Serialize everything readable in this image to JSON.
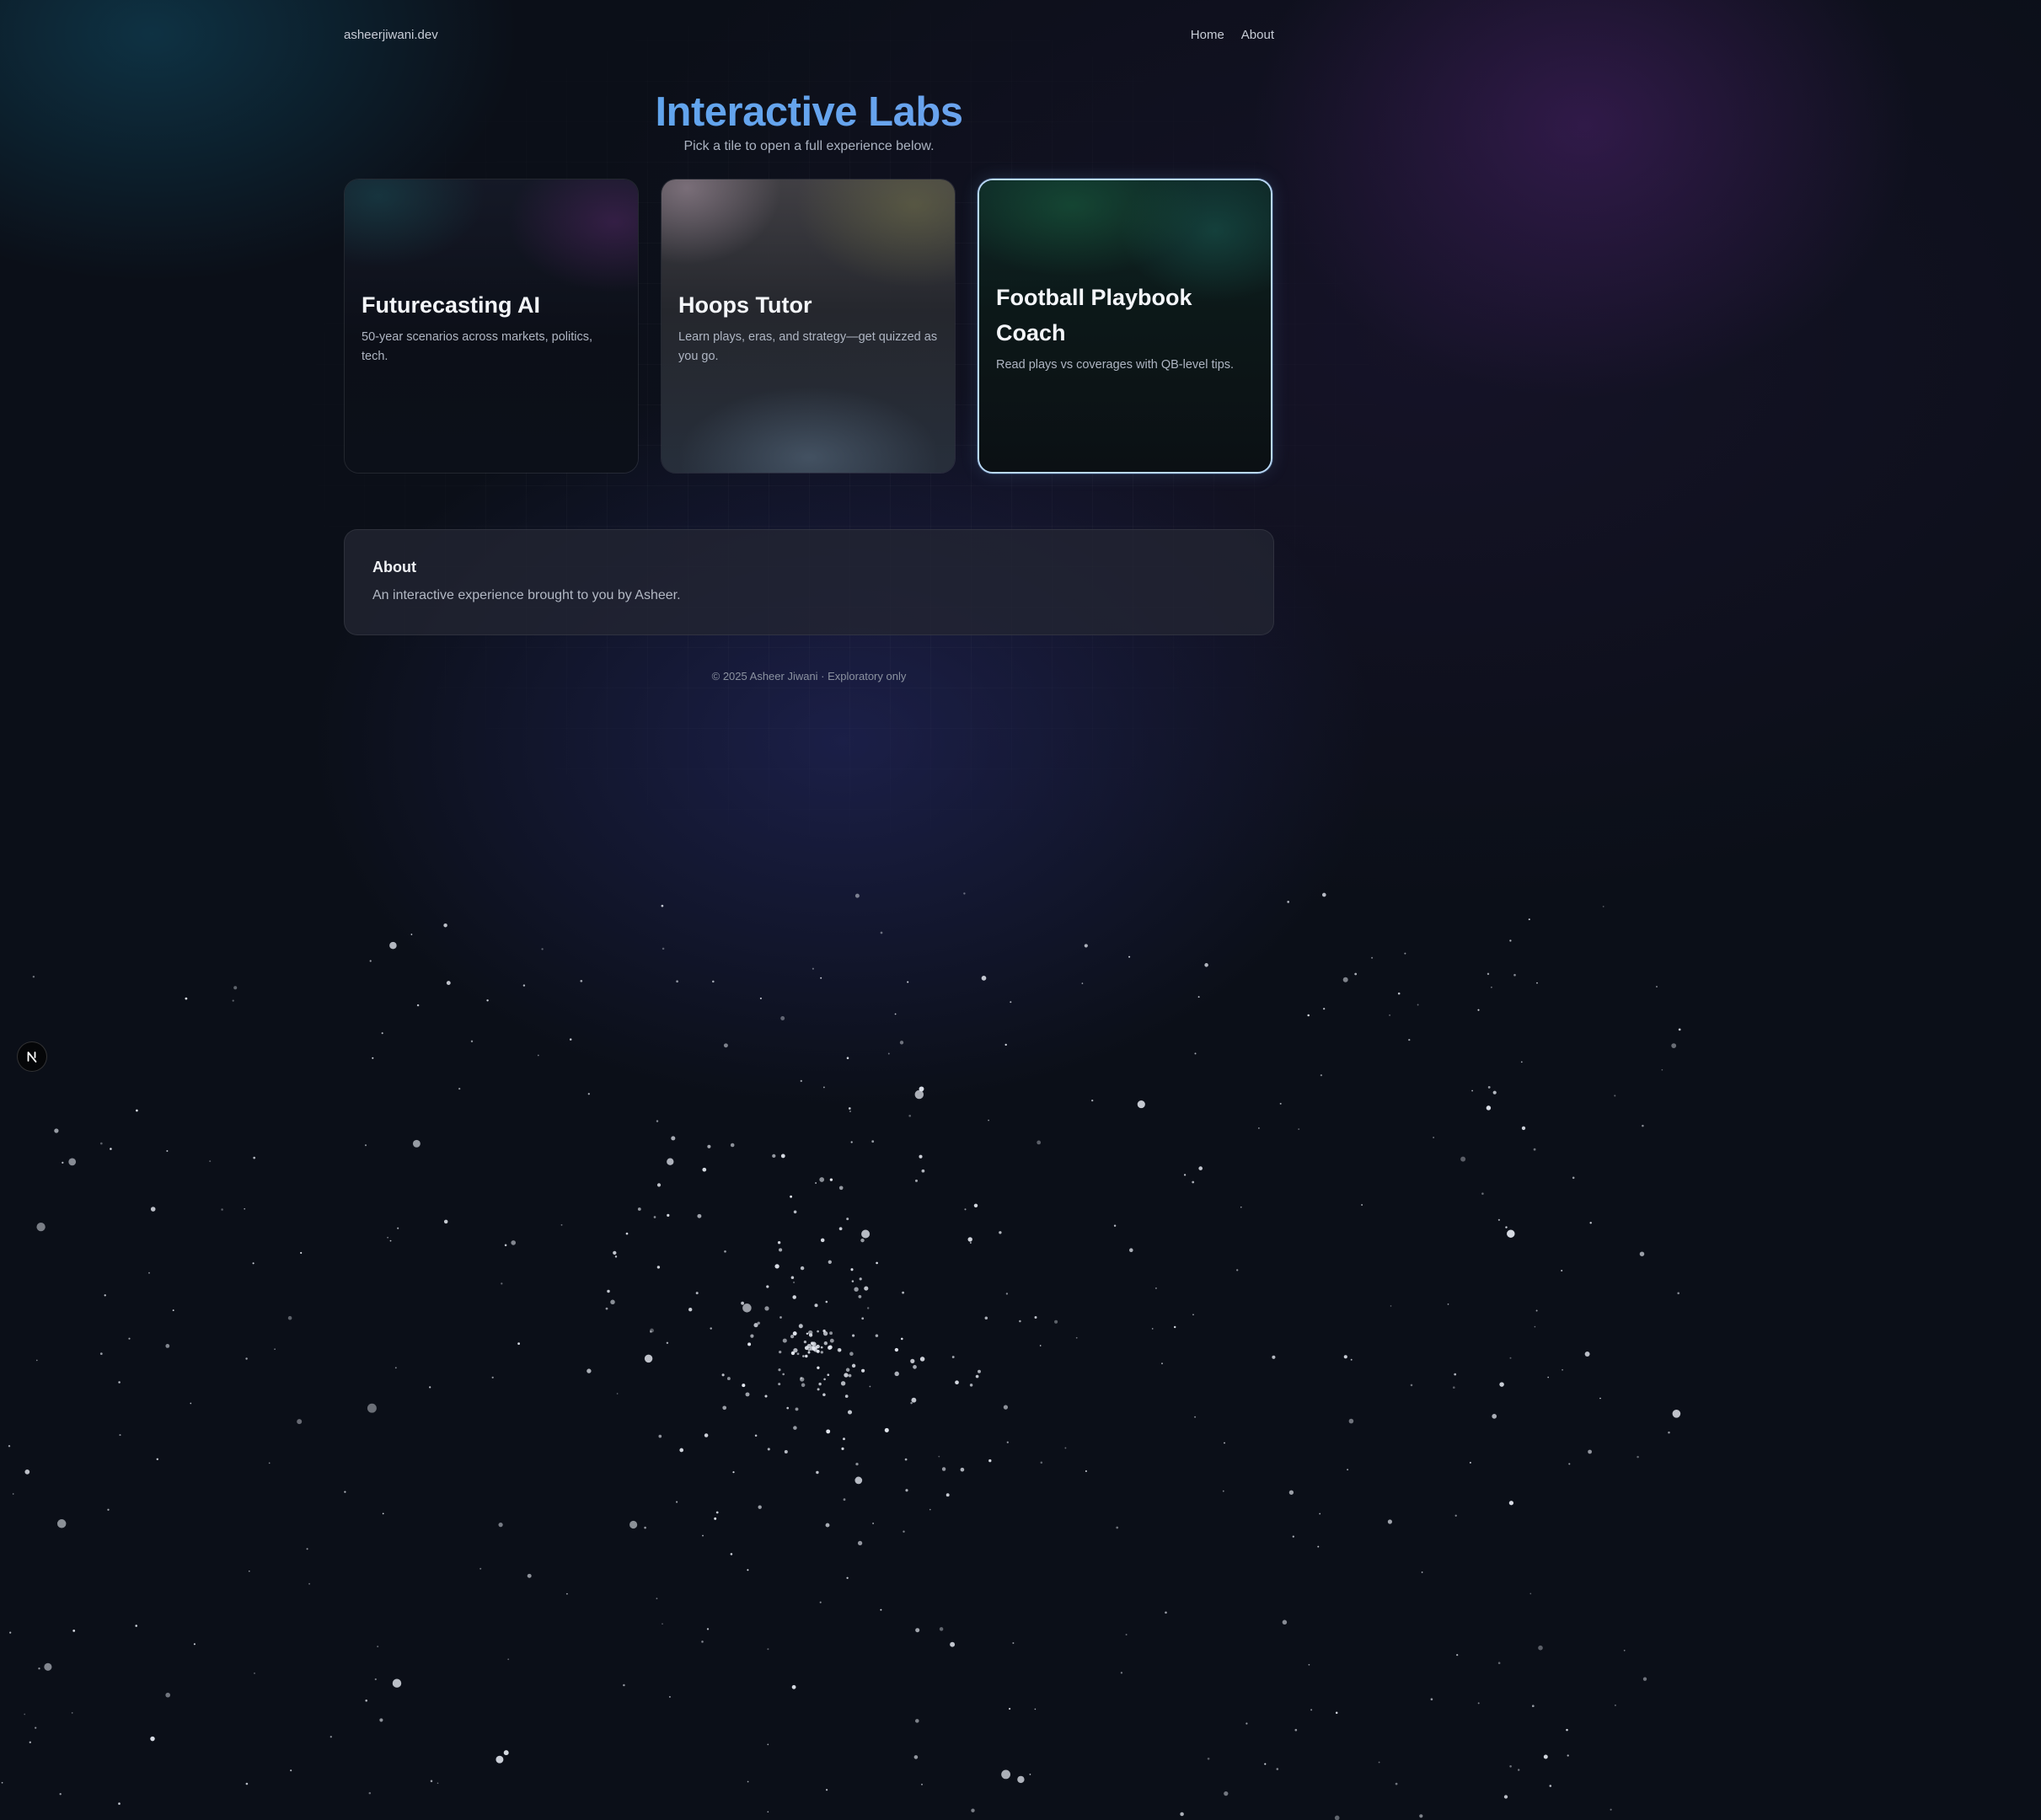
{
  "header": {
    "brand": "asheerjiwani.dev",
    "nav": [
      "Home",
      "About"
    ]
  },
  "hero": {
    "title": "Interactive Labs",
    "subtitle": "Pick a tile to open a full experience below."
  },
  "tiles": [
    {
      "title": "Futurecasting AI",
      "description": "50-year scenarios across markets, politics, tech.",
      "selected": false
    },
    {
      "title": "Hoops Tutor",
      "description": "Learn plays, eras, and strategy—get quizzed as you go.",
      "selected": false
    },
    {
      "title": "Football Playbook Coach",
      "description": "Read plays vs coverages with QB-level tips.",
      "selected": true
    }
  ],
  "about": {
    "heading": "About",
    "text": "An interactive experience brought to you by Asheer."
  },
  "footer": {
    "text": "© 2025 Asheer Jiwani · Exploratory only"
  },
  "dev_badge": {
    "icon": "nextjs-n-icon"
  },
  "colors": {
    "background": "#0b0f18",
    "title_gradient_start": "#4ea8ea",
    "title_gradient_end": "#8b8fe6",
    "selected_border": "#b9d8f5",
    "muted_text": "#aab2c0"
  },
  "background": {
    "starfield_icon": "starfield-icon"
  }
}
